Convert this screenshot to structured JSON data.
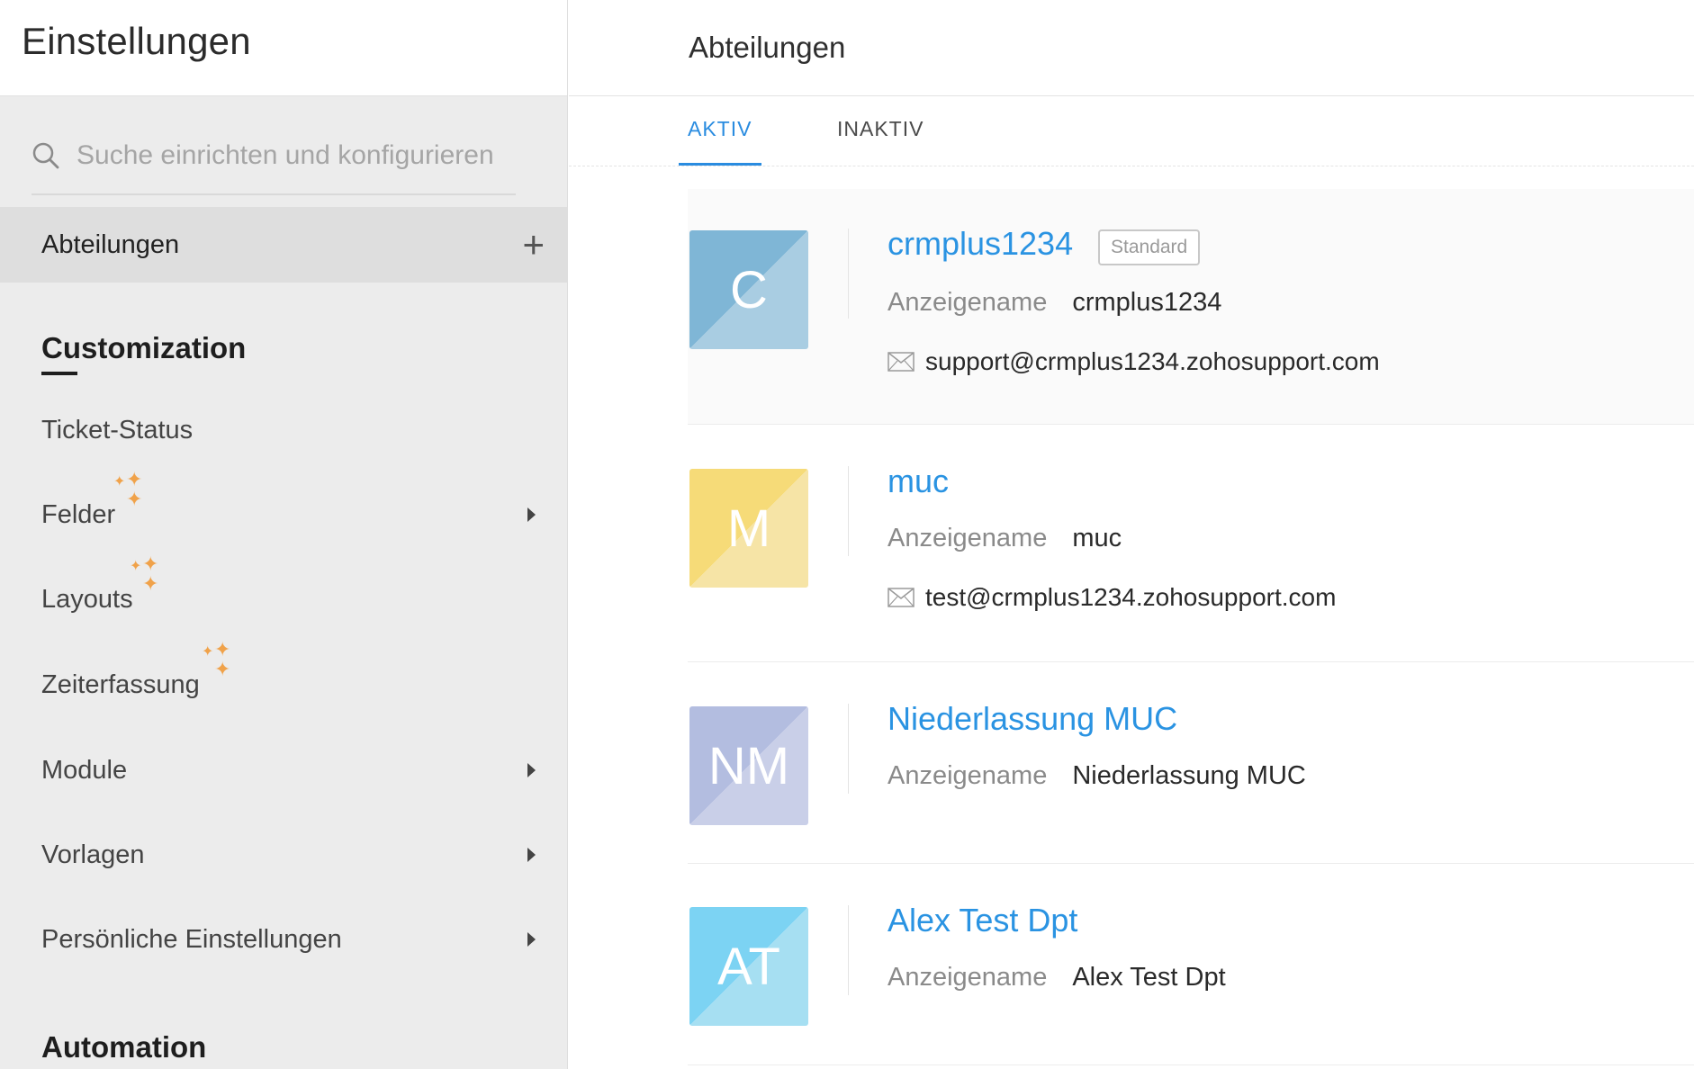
{
  "sidebar": {
    "title": "Einstellungen",
    "search_placeholder": "Suche einrichten und konfigurieren",
    "active_item": "Abteilungen",
    "sections": [
      {
        "title": "Customization",
        "items": [
          {
            "label": "Ticket-Status"
          },
          {
            "label": "Felder"
          },
          {
            "label": "Layouts"
          },
          {
            "label": "Zeiterfassung"
          },
          {
            "label": "Module"
          },
          {
            "label": "Vorlagen"
          },
          {
            "label": "Persönliche Einstellungen"
          }
        ]
      },
      {
        "title": "Automation"
      }
    ]
  },
  "main": {
    "title": "Abteilungen",
    "tabs": [
      {
        "label": "AKTIV",
        "active": true
      },
      {
        "label": "INAKTIV",
        "active": false
      }
    ],
    "field_label": "Anzeigename",
    "departments": [
      {
        "initials": "C",
        "name": "crmplus1234",
        "badge": "Standard",
        "display_name": "crmplus1234",
        "email": "support@crmplus1234.zohosupport.com",
        "color_a": "#7fb6d6",
        "color_b": "#a9cde2"
      },
      {
        "initials": "M",
        "name": "muc",
        "display_name": "muc",
        "email": "test@crmplus1234.zohosupport.com",
        "color_a": "#f6db78",
        "color_b": "#f6e4a6"
      },
      {
        "initials": "NM",
        "name": "Niederlassung MUC",
        "display_name": "Niederlassung MUC",
        "color_a": "#b3bde0",
        "color_b": "#c9cfe8"
      },
      {
        "initials": "AT",
        "name": "Alex Test Dpt",
        "display_name": "Alex Test Dpt",
        "color_a": "#7cd3f3",
        "color_b": "#a6dff2"
      }
    ]
  },
  "colors": {
    "accent": "#2a8ce0",
    "sparkle": "#f0a24a"
  }
}
